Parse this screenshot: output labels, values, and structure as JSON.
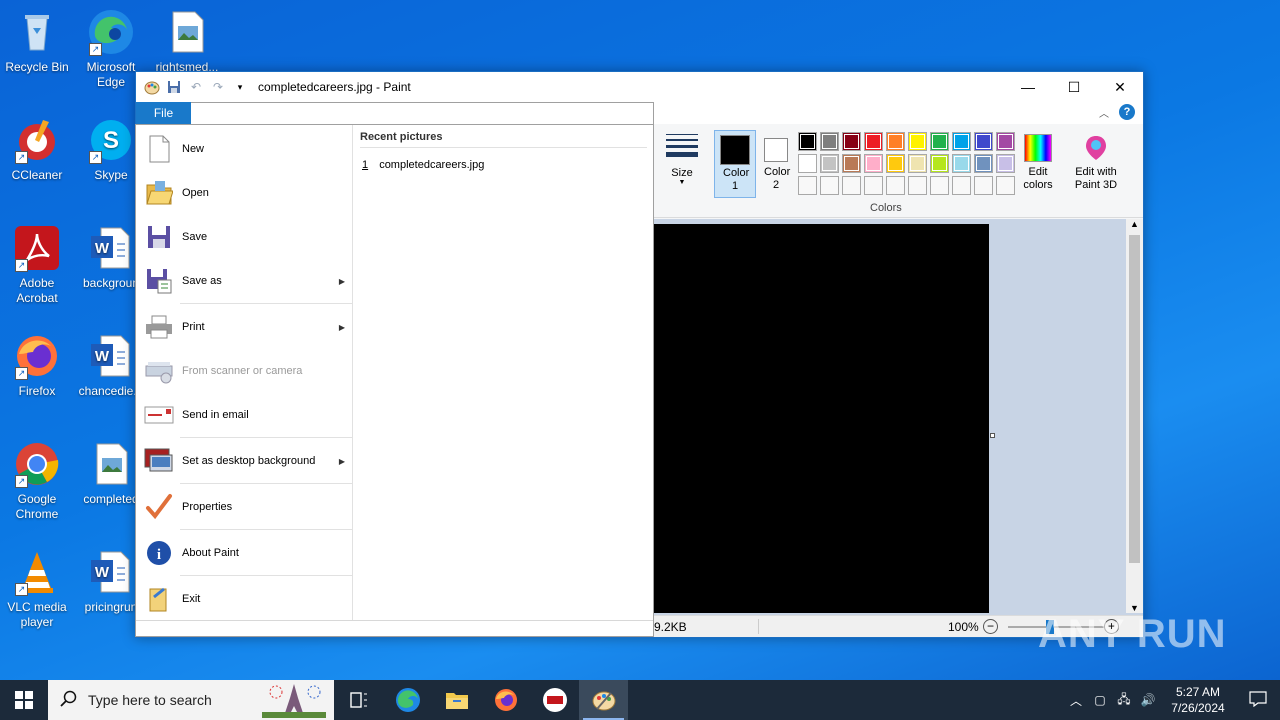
{
  "desktop": {
    "icons": [
      {
        "label": "Recycle Bin"
      },
      {
        "label": "Microsoft Edge"
      },
      {
        "label": "rightsmed..."
      },
      {
        "label": "CCleaner"
      },
      {
        "label": "Skype"
      },
      {
        "label": "Adobe Acrobat"
      },
      {
        "label": "backgroun"
      },
      {
        "label": "Firefox"
      },
      {
        "label": "chancedie..."
      },
      {
        "label": "Google Chrome"
      },
      {
        "label": "completed"
      },
      {
        "label": "VLC media player"
      },
      {
        "label": "pricingrun"
      }
    ]
  },
  "window": {
    "title": "completedcareers.jpg - Paint",
    "controls": {
      "minimize": "—",
      "maximize": "☐",
      "close": "✕"
    },
    "file_tab": "File",
    "help": "?",
    "ribbon": {
      "size_label": "Size",
      "color1_label": "Color 1",
      "color2_label": "Color 2",
      "edit_colors_label": "Edit colors",
      "edit_paint3d_label": "Edit with Paint 3D",
      "colors_group_label": "Colors",
      "color1": "#000000",
      "color2": "#ffffff",
      "palette": [
        "#000000",
        "#7f7f7f",
        "#880015",
        "#ed1c24",
        "#ff7f27",
        "#fff200",
        "#22b14c",
        "#00a2e8",
        "#3f48cc",
        "#a349a4",
        "#ffffff",
        "#c3c3c3",
        "#b97a57",
        "#ffaec9",
        "#ffc90e",
        "#efe4b0",
        "#b5e61d",
        "#99d9ea",
        "#7092be",
        "#c8bfe7"
      ]
    },
    "status": {
      "file_size": "9.2KB",
      "zoom": "100%"
    }
  },
  "file_menu": {
    "items": [
      {
        "label": "New",
        "icon": "new-document-icon",
        "enabled": true
      },
      {
        "label": "Open",
        "icon": "open-folder-icon",
        "enabled": true
      },
      {
        "label": "Save",
        "icon": "save-disk-icon",
        "enabled": true
      },
      {
        "label": "Save as",
        "icon": "save-as-icon",
        "enabled": true,
        "submenu": true
      },
      {
        "label": "Print",
        "icon": "printer-icon",
        "enabled": true,
        "submenu": true
      },
      {
        "label": "From scanner or camera",
        "icon": "scanner-icon",
        "enabled": false
      },
      {
        "label": "Send in email",
        "icon": "email-icon",
        "enabled": true
      },
      {
        "label": "Set as desktop background",
        "icon": "desktop-background-icon",
        "enabled": true,
        "submenu": true
      },
      {
        "label": "Properties",
        "icon": "checkmark-icon",
        "enabled": true
      },
      {
        "label": "About Paint",
        "icon": "info-icon",
        "enabled": true
      },
      {
        "label": "Exit",
        "icon": "exit-icon",
        "enabled": true
      }
    ],
    "recent_header": "Recent pictures",
    "recent": [
      {
        "num": "1",
        "name": "completedcareers.jpg"
      }
    ]
  },
  "taskbar": {
    "search_placeholder": "Type here to search",
    "time": "5:27 AM",
    "date": "7/26/2024"
  },
  "watermark": "ANY RUN"
}
